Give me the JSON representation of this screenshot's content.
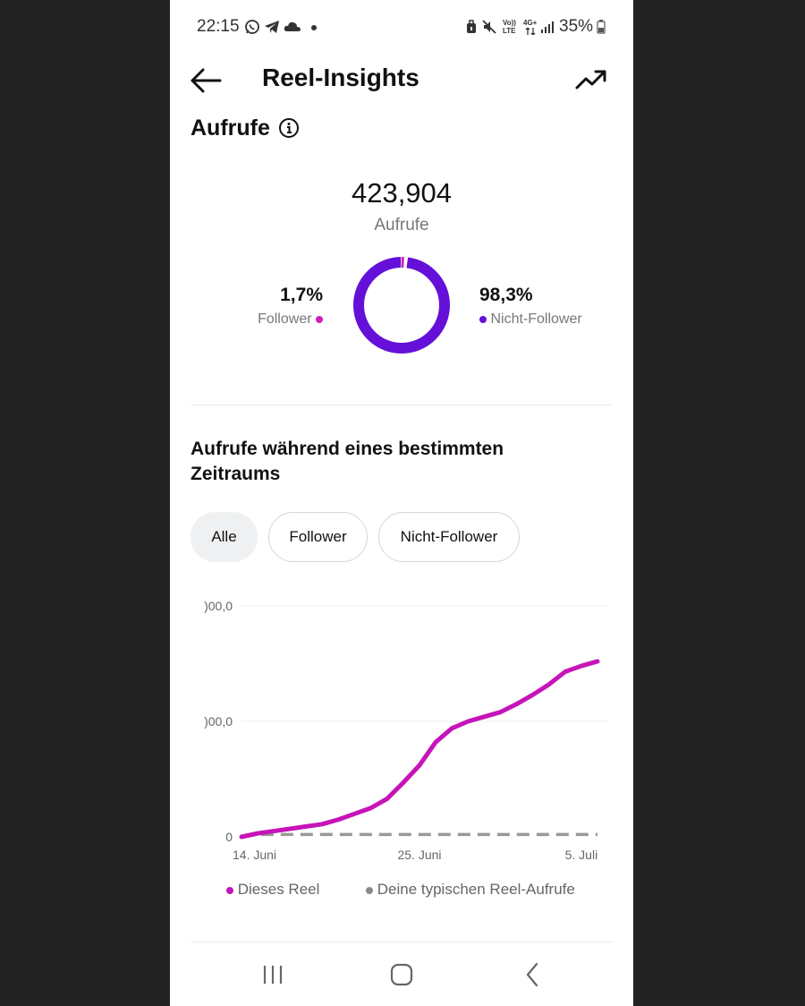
{
  "status_bar": {
    "time": "22:15",
    "network_top": "4G+",
    "volte_top": "Vo))",
    "volte_bottom": "LTE",
    "battery": "35%",
    "icons": [
      "whatsapp-icon",
      "telegram-icon",
      "cloud-icon",
      "dot-icon",
      "lock-icon",
      "mute-icon",
      "volte-icon",
      "network-4g-icon",
      "signal-icon",
      "battery-icon"
    ]
  },
  "header": {
    "title": "Reel-Insights",
    "back_icon": "arrow-left-icon",
    "trend_icon": "trending-up-icon"
  },
  "views": {
    "heading": "Aufrufe",
    "total": "423,904",
    "total_label": "Aufrufe",
    "follower_pct": "1,7%",
    "follower_label": "Follower",
    "nonfollower_pct": "98,3%",
    "nonfollower_label": "Nicht-Follower",
    "follower_share": 0.017,
    "nonfollower_share": 0.983,
    "colors": {
      "follower": "#d11fbf",
      "nonfollower": "#6410d8"
    }
  },
  "period": {
    "heading": "Aufrufe während eines bestimmten Zeitraums",
    "chips": [
      {
        "label": "Alle",
        "selected": true
      },
      {
        "label": "Follower",
        "selected": false
      },
      {
        "label": "Nicht-Follower",
        "selected": false
      }
    ]
  },
  "chart_data": {
    "type": "line",
    "x_tick_labels": [
      "14. Juni",
      "25. Juni",
      "5. Juli"
    ],
    "y_tick_labels": [
      ")00,0",
      ")00,0",
      "0"
    ],
    "y_tick_values": [
      2,
      1,
      0
    ],
    "x": [
      "14. Juni",
      "15. Juni",
      "16. Juni",
      "17. Juni",
      "18. Juni",
      "19. Juni",
      "20. Juni",
      "21. Juni",
      "22. Juni",
      "23. Juni",
      "24. Juni",
      "25. Juni",
      "26. Juni",
      "27. Juni",
      "28. Juni",
      "29. Juni",
      "30. Juni",
      "1. Juli",
      "2. Juli",
      "3. Juli",
      "4. Juli",
      "5. Juli",
      "6. Juli"
    ],
    "ylim": [
      0,
      2
    ],
    "grid": true,
    "series": [
      {
        "name": "Dieses Reel",
        "color": "#c614b8",
        "values": [
          0.0,
          0.03,
          0.05,
          0.07,
          0.09,
          0.11,
          0.15,
          0.2,
          0.25,
          0.33,
          0.47,
          0.62,
          0.82,
          0.94,
          1.0,
          1.04,
          1.08,
          1.15,
          1.23,
          1.32,
          1.43,
          1.48,
          1.52
        ]
      },
      {
        "name": "Deine typischen Reel-Aufrufe",
        "color": "#999999",
        "dashed": true,
        "values": [
          0.0,
          0.02,
          0.02,
          0.02,
          0.02,
          0.02,
          0.02,
          0.02,
          0.02,
          0.02,
          0.02,
          0.02,
          0.02,
          0.02,
          0.02,
          0.02,
          0.02,
          0.02,
          0.02,
          0.02,
          0.02,
          0.02,
          0.02
        ]
      }
    ],
    "legend": "bottom"
  },
  "legend": {
    "this_reel": "Dieses Reel",
    "typical": "Deine typischen Reel-Aufrufe",
    "this_reel_color": "#c614b8",
    "typical_color": "#8a8a8a"
  },
  "nav_bar": {
    "icons": [
      "recent-apps-icon",
      "home-icon",
      "back-icon"
    ]
  }
}
